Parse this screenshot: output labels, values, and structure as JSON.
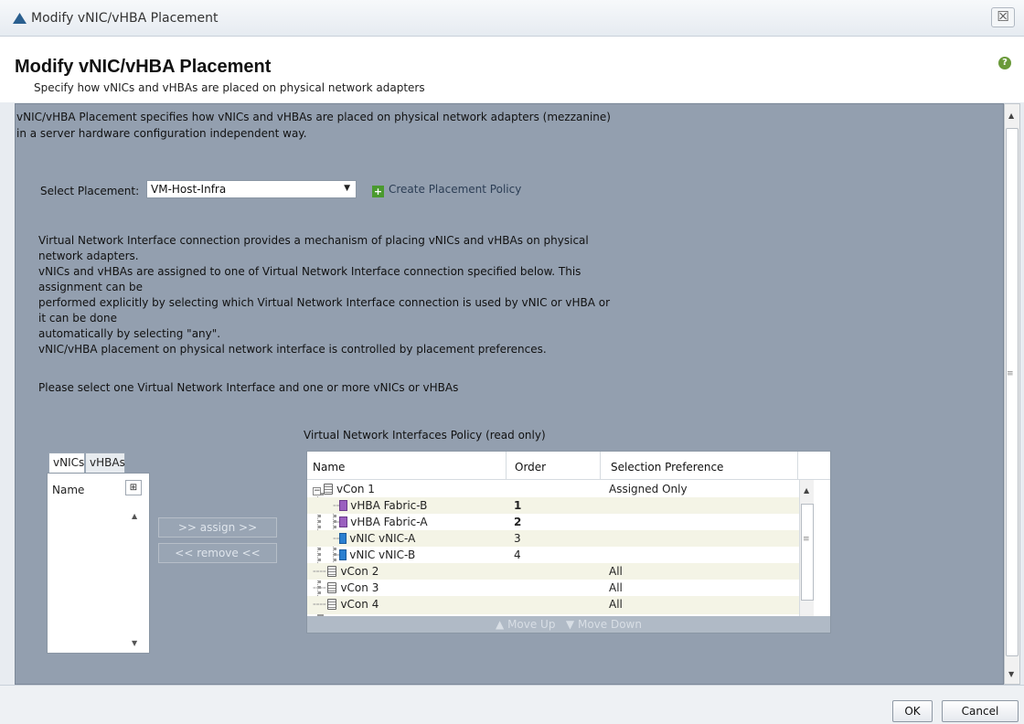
{
  "window": {
    "title": "Modify vNIC/vHBA Placement",
    "close_icon": "close-icon"
  },
  "header": {
    "title": "Modify vNIC/vHBA Placement",
    "subtitle": "Specify how vNICs and vHBAs are placed on physical network adapters",
    "help_icon": "help-icon"
  },
  "description": {
    "line1": "vNIC/vHBA Placement specifies how vNICs and vHBAs are placed on physical network adapters (mezzanine)",
    "line2": "in a server hardware configuration independent way."
  },
  "placement": {
    "label": "Select Placement:",
    "selected": "VM-Host-Infra",
    "create_link": "Create Placement Policy"
  },
  "info_lines": [
    "Virtual Network Interface connection provides a mechanism of placing vNICs and vHBAs on physical",
    "network adapters.",
    "vNICs and vHBAs are assigned to one of Virtual Network Interface connection specified below. This",
    "assignment can be",
    "performed explicitly by selecting which Virtual Network Interface connection is used by vNIC or vHBA or",
    "it can be done",
    "automatically by selecting \"any\".",
    "vNIC/vHBA placement on physical network interface is controlled by placement preferences.",
    "",
    "Please select one Virtual Network Interface and one or more vNICs or vHBAs"
  ],
  "left_panel": {
    "tabs": [
      "vNICs",
      "vHBAs"
    ],
    "active_tab": "vNICs",
    "column": "Name"
  },
  "actions": {
    "assign": ">> assign >>",
    "remove": "<< remove <<"
  },
  "policy": {
    "title": "Virtual Network Interfaces Policy (read only)",
    "columns": [
      "Name",
      "Order",
      "Selection Preference"
    ],
    "rows": [
      {
        "name": "vCon 1",
        "order": "",
        "pref": "Assigned Only",
        "type": "vcon",
        "level": 0
      },
      {
        "name": "vHBA Fabric-B",
        "order": "1",
        "pref": "",
        "type": "vhba",
        "level": 1
      },
      {
        "name": "vHBA Fabric-A",
        "order": "2",
        "pref": "",
        "type": "vhba",
        "level": 1
      },
      {
        "name": "vNIC vNIC-A",
        "order": "3",
        "pref": "",
        "type": "vnic",
        "level": 1
      },
      {
        "name": "vNIC vNIC-B",
        "order": "4",
        "pref": "",
        "type": "vnic",
        "level": 1
      },
      {
        "name": "vCon 2",
        "order": "",
        "pref": "All",
        "type": "vcon",
        "level": 0
      },
      {
        "name": "vCon 3",
        "order": "",
        "pref": "All",
        "type": "vcon",
        "level": 0
      },
      {
        "name": "vCon 4",
        "order": "",
        "pref": "All",
        "type": "vcon",
        "level": 0
      }
    ],
    "move_up": "Move Up",
    "move_down": "Move Down"
  },
  "footer": {
    "ok": "OK",
    "cancel": "Cancel"
  },
  "colors": {
    "panel_bg": "#939faf",
    "accent_green": "#4a9a2e",
    "vhba": "#9a5fbf",
    "vnic": "#2a7fd0"
  }
}
